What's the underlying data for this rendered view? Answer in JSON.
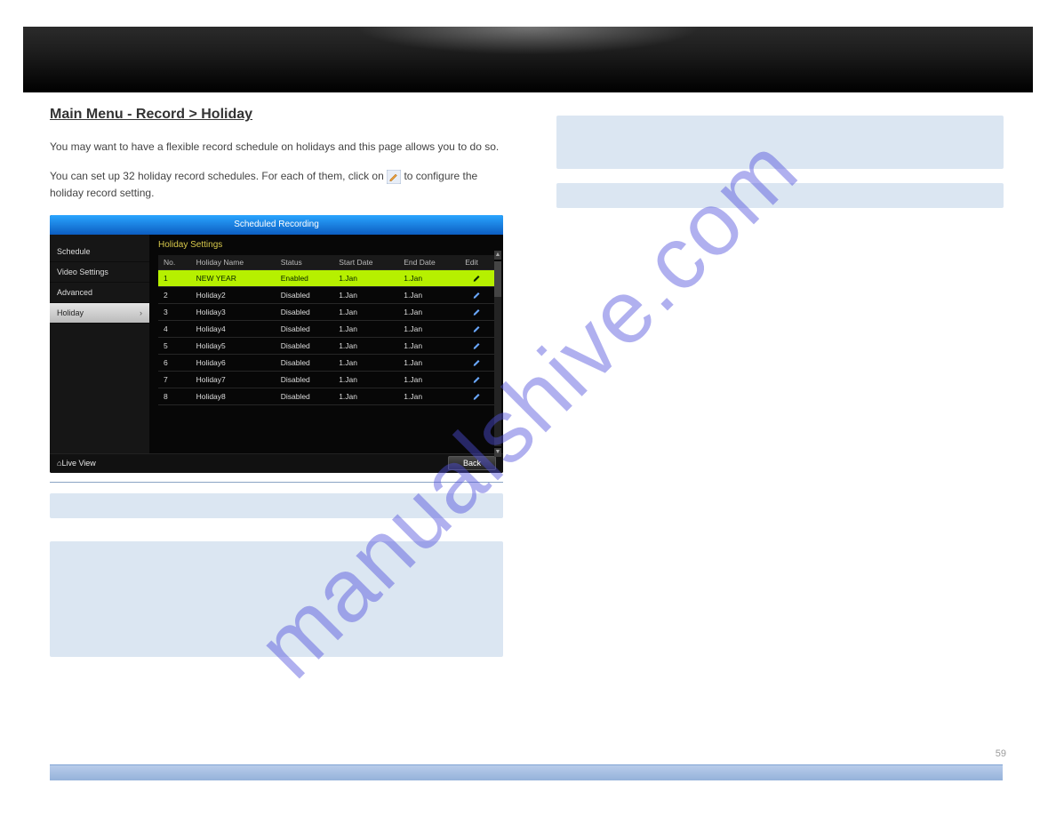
{
  "watermark_text": "manualshive.com",
  "page_number": "59",
  "heading": "Main Menu - Record > Holiday",
  "intro": {
    "p1": "You may want to have a flexible record schedule on holidays and this page allows you to do so.",
    "p2_part1": "You can set up 32 holiday record schedules. For each of them, click on",
    "p2_part2": " to configure the holiday record setting."
  },
  "edit_icon_alt": "edit-pencil-icon",
  "dvr": {
    "title": "Scheduled Recording",
    "sidebar": {
      "items": [
        {
          "label": "Schedule",
          "active": false
        },
        {
          "label": "Video Settings",
          "active": false
        },
        {
          "label": "Advanced",
          "active": false
        },
        {
          "label": "Holiday",
          "active": true
        }
      ]
    },
    "content_title": "Holiday Settings",
    "columns": [
      "No.",
      "Holiday Name",
      "Status",
      "Start Date",
      "End Date",
      "Edit"
    ],
    "rows": [
      {
        "no": "1",
        "name": "NEW YEAR",
        "status": "Enabled",
        "start": "1.Jan",
        "end": "1.Jan",
        "selected": true
      },
      {
        "no": "2",
        "name": "Holiday2",
        "status": "Disabled",
        "start": "1.Jan",
        "end": "1.Jan",
        "selected": false
      },
      {
        "no": "3",
        "name": "Holiday3",
        "status": "Disabled",
        "start": "1.Jan",
        "end": "1.Jan",
        "selected": false
      },
      {
        "no": "4",
        "name": "Holiday4",
        "status": "Disabled",
        "start": "1.Jan",
        "end": "1.Jan",
        "selected": false
      },
      {
        "no": "5",
        "name": "Holiday5",
        "status": "Disabled",
        "start": "1.Jan",
        "end": "1.Jan",
        "selected": false
      },
      {
        "no": "6",
        "name": "Holiday6",
        "status": "Disabled",
        "start": "1.Jan",
        "end": "1.Jan",
        "selected": false
      },
      {
        "no": "7",
        "name": "Holiday7",
        "status": "Disabled",
        "start": "1.Jan",
        "end": "1.Jan",
        "selected": false
      },
      {
        "no": "8",
        "name": "Holiday8",
        "status": "Disabled",
        "start": "1.Jan",
        "end": "1.Jan",
        "selected": false
      }
    ],
    "live_view_label": "Live View",
    "back_label": "Back"
  },
  "left_boxes": {
    "box1": "",
    "box2": ""
  },
  "right_boxes": {
    "box1": "",
    "box2": ""
  }
}
